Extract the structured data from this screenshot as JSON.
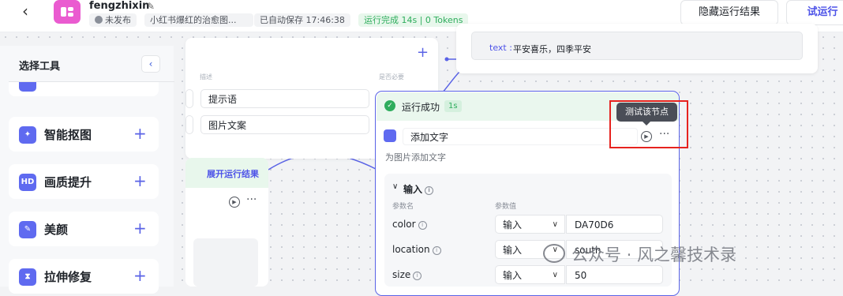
{
  "header": {
    "app_name": "fengzhixin",
    "status": "未发布",
    "description": "小红书爆红的治愈图...",
    "autosave": "已自动保存 17:46:38",
    "run_status": "运行完成 14s | 0 Tokens",
    "hide_results_label": "隐藏运行结果",
    "test_run_label": "试运行",
    "accent_color": "#4d53e8"
  },
  "tool_panel": {
    "title": "选择工具",
    "items": [
      {
        "label": "智能抠图",
        "icon": "cutout-icon"
      },
      {
        "label": "画质提升",
        "icon": "hd-icon"
      },
      {
        "label": "美颜",
        "icon": "beauty-icon"
      },
      {
        "label": "拉伸修复",
        "icon": "stretch-icon"
      }
    ]
  },
  "param_card": {
    "col_desc": "描述",
    "col_required": "是否必要",
    "row1_desc": "提示语",
    "row2_desc": "图片文案"
  },
  "left_node": {
    "expand_label": "展开运行结果"
  },
  "text_output": {
    "key": "text :",
    "value": "平安喜乐，四季平安"
  },
  "main_node": {
    "status": "运行成功",
    "duration": "1s",
    "name": "添加文字",
    "description": "为图片添加文字",
    "tooltip": "测试该节点",
    "input_title": "输入",
    "col_param_name": "参数名",
    "col_param_value": "参数值",
    "params": [
      {
        "name": "color",
        "mode": "输入",
        "value": "DA70D6"
      },
      {
        "name": "location",
        "mode": "输入",
        "value": "south"
      },
      {
        "name": "size",
        "mode": "输入",
        "value": "50"
      }
    ],
    "success_color": "#2fad5d"
  },
  "watermark": "公众号 · 风之馨技术录"
}
